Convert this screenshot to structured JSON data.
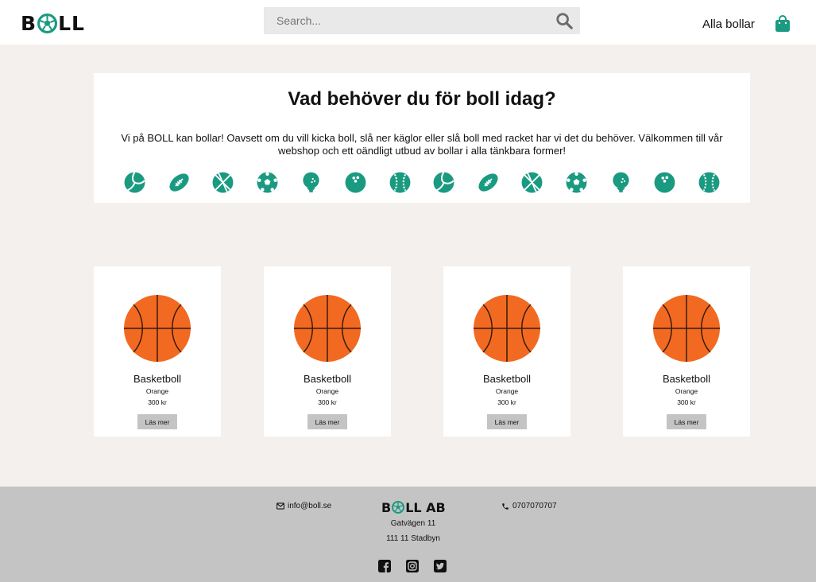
{
  "header": {
    "logo_pre": "B",
    "logo_post": "LL",
    "search_placeholder": "Search...",
    "nav_link": "Alla bollar"
  },
  "intro": {
    "heading": "Vad behöver du för boll idag?",
    "text": "Vi på BOLL kan bollar! Oavsett om du vill kicka boll, slå ner käglor eller slå boll med racket har vi det du behöver. Välkommen till vår webshop och ett oändligt utbud av bollar i alla tänkbara former!",
    "categories": [
      "volleyball",
      "football",
      "basketball",
      "soccer",
      "golf",
      "bowling",
      "baseball",
      "volleyball",
      "football",
      "basketball",
      "soccer",
      "golf",
      "bowling",
      "baseball"
    ]
  },
  "products": [
    {
      "name": "Basketboll",
      "color": "Orange",
      "price": "300 kr",
      "button": "Läs mer"
    },
    {
      "name": "Basketboll",
      "color": "Orange",
      "price": "300 kr",
      "button": "Läs mer"
    },
    {
      "name": "Basketboll",
      "color": "Orange",
      "price": "300 kr",
      "button": "Läs mer"
    },
    {
      "name": "Basketboll",
      "color": "Orange",
      "price": "300 kr",
      "button": "Läs mer"
    }
  ],
  "footer": {
    "email": "info@boll.se",
    "phone": "0707070707",
    "logo_pre": "B",
    "logo_post": "LL AB",
    "address_line1": "Gatvägen 11",
    "address_line2": "111 11 Stadbyn",
    "social": [
      "facebook",
      "instagram",
      "twitter"
    ]
  },
  "colors": {
    "accent": "#1a9a80",
    "background": "#f3f0ee",
    "footer": "#c4c4c4",
    "button": "#c4c4c4",
    "ball": "#f26a21"
  }
}
